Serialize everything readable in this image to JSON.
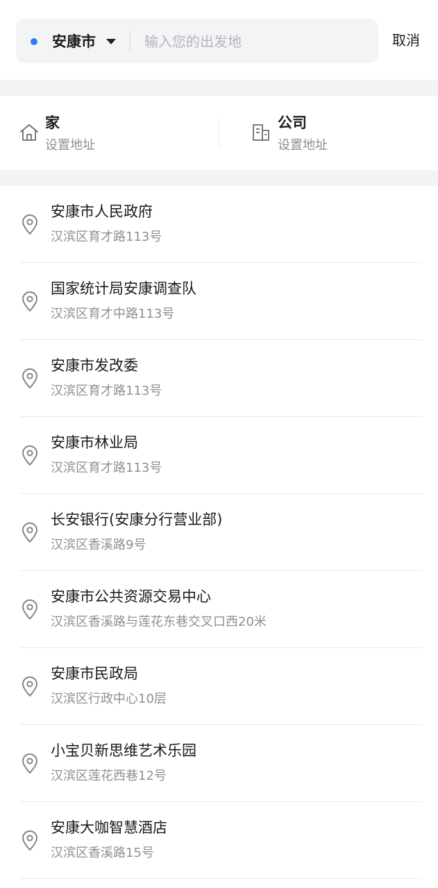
{
  "search": {
    "city": "安康市",
    "placeholder": "输入您的出发地",
    "value": "",
    "cancel_label": "取消",
    "accent_color": "#2f7cf6"
  },
  "shortcuts": {
    "home": {
      "title": "家",
      "subtitle": "设置地址",
      "icon": "home-icon"
    },
    "company": {
      "title": "公司",
      "subtitle": "设置地址",
      "icon": "building-icon"
    }
  },
  "places": [
    {
      "name": "安康市人民政府",
      "address": "汉滨区育才路113号"
    },
    {
      "name": "国家统计局安康调查队",
      "address": "汉滨区育才中路113号"
    },
    {
      "name": "安康市发改委",
      "address": "汉滨区育才路113号"
    },
    {
      "name": "安康市林业局",
      "address": "汉滨区育才路113号"
    },
    {
      "name": "长安银行(安康分行营业部)",
      "address": "汉滨区香溪路9号"
    },
    {
      "name": "安康市公共资源交易中心",
      "address": "汉滨区香溪路与莲花东巷交叉口西20米"
    },
    {
      "name": "安康市民政局",
      "address": "汉滨区行政中心10层"
    },
    {
      "name": "小宝贝新思维艺术乐园",
      "address": "汉滨区莲花西巷12号"
    },
    {
      "name": "安康大咖智慧酒店",
      "address": "汉滨区香溪路15号"
    }
  ]
}
